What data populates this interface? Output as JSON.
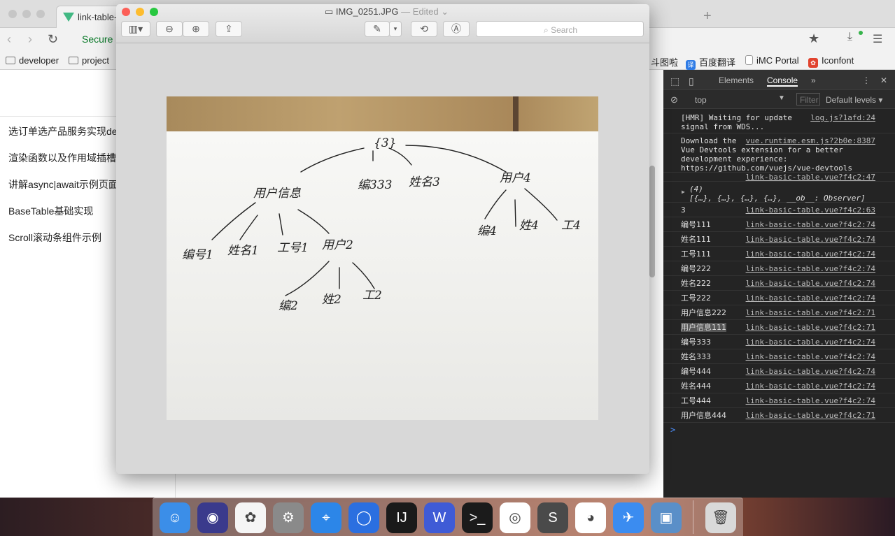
{
  "browser": {
    "tab_title": "link-table-",
    "secure_label": "Secure",
    "bookmarks": [
      {
        "label": "developer",
        "icon": "folder-icon"
      },
      {
        "label": "project",
        "icon": "folder-icon"
      },
      {
        "label": "斗图啦",
        "icon": ""
      },
      {
        "label": "百度翻译",
        "icon": "translate-icon"
      },
      {
        "label": "iMC Portal",
        "icon": "page-icon"
      },
      {
        "label": "Iconfont",
        "icon": "iconfont-icon"
      }
    ]
  },
  "sidebar": {
    "items": [
      {
        "label": "选订单选产品服务实现de"
      },
      {
        "label": "渲染函数以及作用域插槽"
      },
      {
        "label": "讲解async|await示例页面"
      },
      {
        "label": "BaseTable基础实现"
      },
      {
        "label": "Scroll滚动条组件示例"
      }
    ]
  },
  "preview": {
    "file_name": "IMG_0251.JPG",
    "edited_label": "— Edited",
    "search_placeholder": "Search",
    "handwriting": {
      "root": "{3}",
      "user_info": "用户信息",
      "no333": "编333",
      "name3": "姓名3",
      "user4": "用户4",
      "no1": "编号1",
      "name1": "姓名1",
      "worker1": "工号1",
      "user2": "用户2",
      "no2": "编2",
      "name2": "姓2",
      "worker2": "工2",
      "no4": "编4",
      "name4": "姓4",
      "worker4": "工4"
    }
  },
  "devtools": {
    "tabs": [
      "Elements",
      "Console"
    ],
    "active_tab": "Console",
    "context": "top",
    "filter_placeholder": "Filter",
    "levels": "Default levels",
    "logs": [
      {
        "msg": "[HMR] Waiting for update\nsignal from WDS...",
        "src": "log.js?1afd:24"
      },
      {
        "msg": "Download the  \nVue Devtools extension for a better\ndevelopment experience:\nhttps://github.com/vuejs/vue-devtools",
        "src": "vue.runtime.esm.js?2b0e:8387"
      },
      {
        "msg": "",
        "src": "link-basic-table.vue?f4c2:47"
      },
      {
        "msg": "(4)\n[{…}, {…}, {…}, {…}, __ob__: Observer]",
        "src": ""
      },
      {
        "msg": "3",
        "src": "link-basic-table.vue?f4c2:63"
      },
      {
        "msg": "编号111",
        "src": "link-basic-table.vue?f4c2:74"
      },
      {
        "msg": "姓名111",
        "src": "link-basic-table.vue?f4c2:74"
      },
      {
        "msg": "工号111",
        "src": "link-basic-table.vue?f4c2:74"
      },
      {
        "msg": "编号222",
        "src": "link-basic-table.vue?f4c2:74"
      },
      {
        "msg": "姓名222",
        "src": "link-basic-table.vue?f4c2:74"
      },
      {
        "msg": "工号222",
        "src": "link-basic-table.vue?f4c2:74"
      },
      {
        "msg": "用户信息222",
        "src": "link-basic-table.vue?f4c2:71"
      },
      {
        "msg": "用户信息111",
        "src": "link-basic-table.vue?f4c2:71"
      },
      {
        "msg": "编号333",
        "src": "link-basic-table.vue?f4c2:74"
      },
      {
        "msg": "姓名333",
        "src": "link-basic-table.vue?f4c2:74"
      },
      {
        "msg": "编号444",
        "src": "link-basic-table.vue?f4c2:74"
      },
      {
        "msg": "姓名444",
        "src": "link-basic-table.vue?f4c2:74"
      },
      {
        "msg": "工号444",
        "src": "link-basic-table.vue?f4c2:74"
      },
      {
        "msg": "用户信息444",
        "src": "link-basic-table.vue?f4c2:71"
      }
    ],
    "prompt": ">"
  },
  "dock": {
    "apps": [
      "finder-icon",
      "siri-icon",
      "photos-icon",
      "system-preferences-icon",
      "safari-icon",
      "quicktime-icon",
      "intellij-icon",
      "wps-icon",
      "terminal-icon",
      "chrome-icon",
      "sublime-icon",
      "qq-icon",
      "dingtalk-icon",
      "preview-icon",
      "trash-icon"
    ]
  },
  "colors": {
    "devtools_bg": "#242424",
    "secure_green": "#0b7a2a",
    "vue_green": "#41b883"
  }
}
